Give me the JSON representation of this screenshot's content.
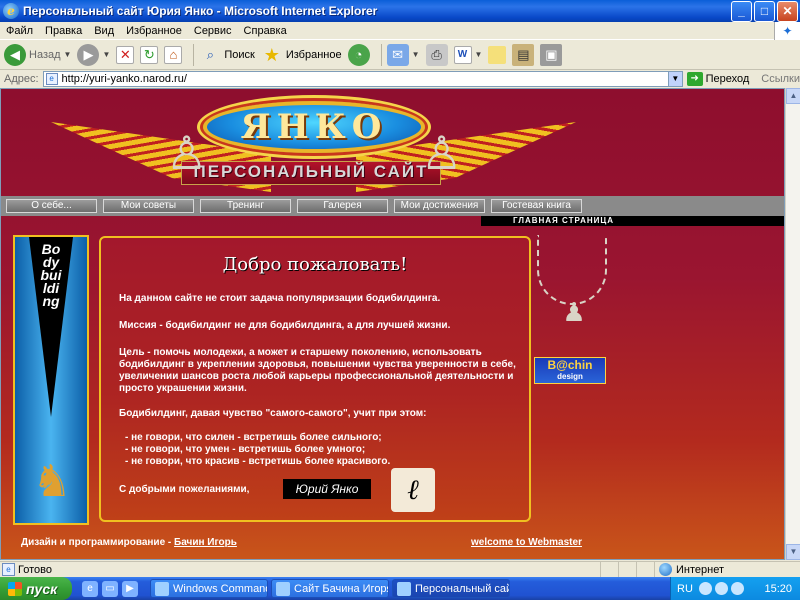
{
  "window": {
    "title": "Персональный сайт Юрия Янко - Microsoft Internet Explorer",
    "buttons": {
      "minimize": "_",
      "maximize": "□",
      "close": "✕"
    }
  },
  "menu": [
    "Файл",
    "Правка",
    "Вид",
    "Избранное",
    "Сервис",
    "Справка"
  ],
  "toolbar": {
    "back": "Назад",
    "search": "Поиск",
    "favorites": "Избранное"
  },
  "address": {
    "label": "Адрес:",
    "url": "http://yuri-yanko.narod.ru/",
    "go": "Переход",
    "links": "Ссылки"
  },
  "page": {
    "logo": "ЯНКО",
    "subtitle": "ПЕРСОНАЛЬНЫЙ САЙТ",
    "nav": [
      "О себе...",
      "Мои советы",
      "Тренинг",
      "Галерея",
      "Мои достижения",
      "Гостевая книга"
    ],
    "main_page_label": "ГЛАВНАЯ СТРАНИЦА",
    "banner_text": "Bodybuilding",
    "heading": "Добро пожаловать!",
    "paragraphs": [
      "На данном сайте не стоит задача популяризации бодибилдинга.",
      "Миссия - бодибилдинг не для бодибилдинга, а для лучшей жизни.",
      "Цель - помочь молодежи, а может и старшему поколению, использовать бодибилдинг в укреплении здоровья, повышении чувства уверенности в себе, увеличении шансов роста любой карьеры профессиональной деятельности и просто украшении жизни.",
      "Бодибилдинг, давая чувство \"самого-самого\", учит при этом:"
    ],
    "bullets": [
      "- не говори, что силен - встретишь более сильного;",
      "- не говори, что умен - встретишь более умного;",
      "- не говори, что красив - встретишь более красивого."
    ],
    "closing": "С добрыми пожеланиями,",
    "signature": "Юрий Янко",
    "badge_main": "B@chin",
    "badge_sub": "design",
    "footer_prefix": "Дизайн и программирование -",
    "footer_author": "Бачин Игорь",
    "footer_right": "welcome to Webmaster"
  },
  "status": {
    "text": "Готово",
    "zone": "Интернет"
  },
  "taskbar": {
    "start": "пуск",
    "tasks": [
      "Windows Commander...",
      "Сайт Бачина Игоря -...",
      "Персональный сайт ..."
    ],
    "lang": "RU",
    "clock": "15:20"
  }
}
